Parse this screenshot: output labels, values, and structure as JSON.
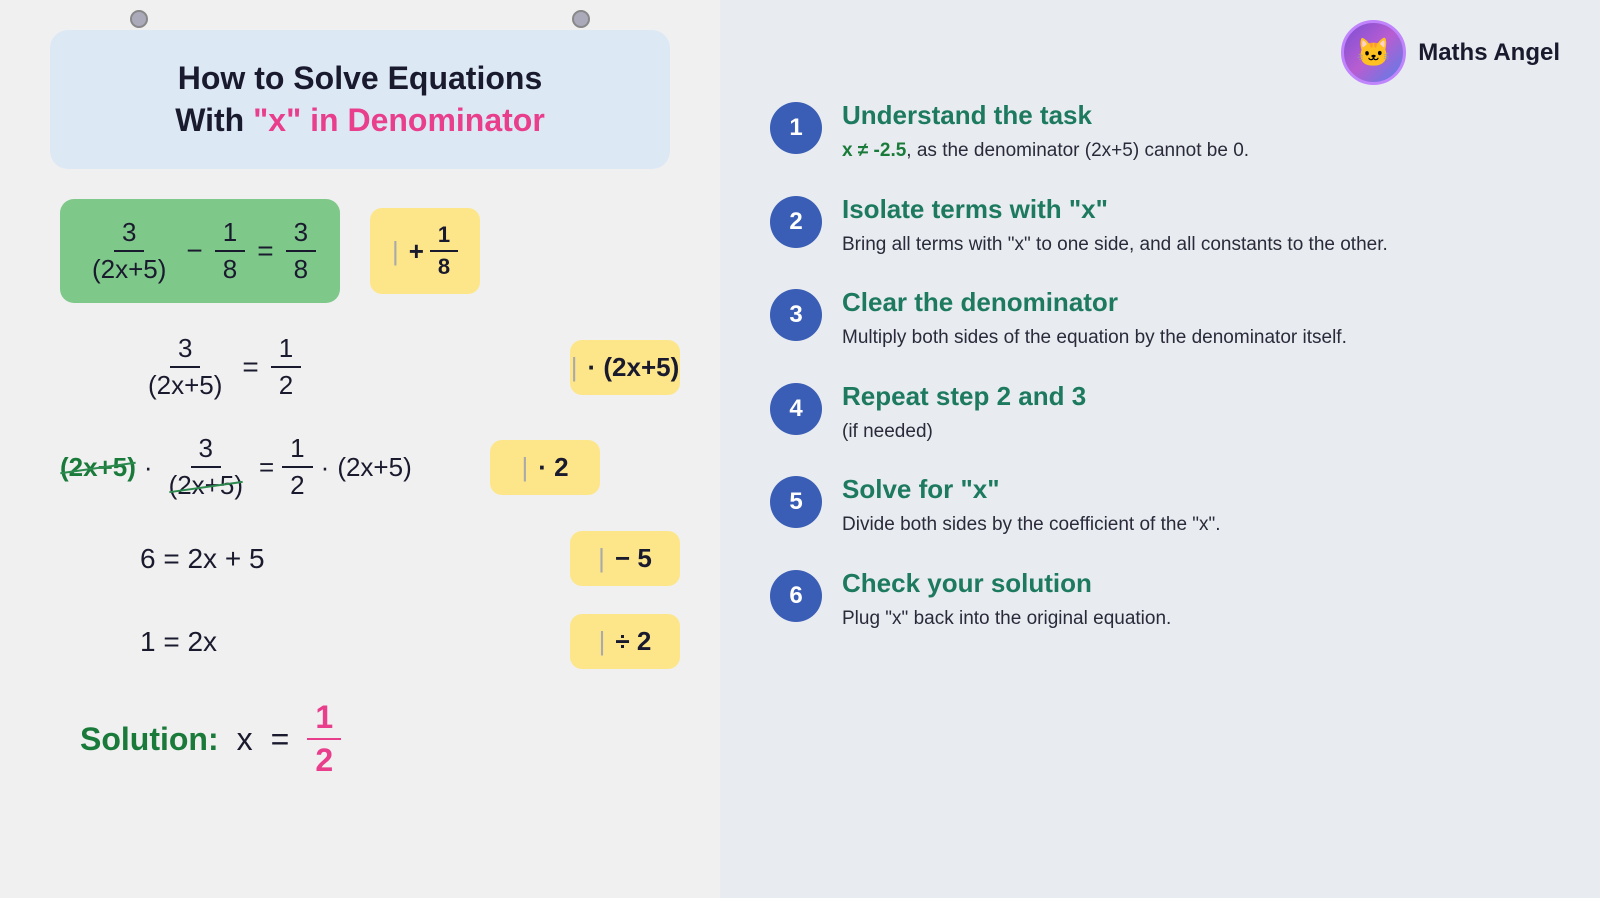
{
  "title": {
    "line1": "How to Solve Equations",
    "line2_plain": "With ",
    "line2_highlight": "\"x\"",
    "line2_end": " in Denominator"
  },
  "branding": {
    "name": "Maths Angel",
    "avatar_emoji": "🐱"
  },
  "steps": [
    {
      "number": "1",
      "title": "Understand the task",
      "desc_html": "<span class='green-inline'>x ≠ -2.5</span>, as the denominator (2x+5) cannot be 0."
    },
    {
      "number": "2",
      "title": "Isolate terms with \"x\"",
      "desc": "Bring all terms with \"x\" to one side, and all constants to the other."
    },
    {
      "number": "3",
      "title": "Clear the denominator",
      "desc": "Multiply both sides of the equation by the denominator itself."
    },
    {
      "number": "4",
      "title": "Repeat step 2 and 3",
      "desc": "(if needed)"
    },
    {
      "number": "5",
      "title": "Solve for \"x\"",
      "desc": "Divide both sides by the coefficient of the \"x\"."
    },
    {
      "number": "6",
      "title": "Check your solution",
      "desc": "Plug \"x\" back into the original equation."
    }
  ],
  "hints": {
    "h1": "+ 1/8",
    "h2": "· (2x+5)",
    "h3": "· 2",
    "h4": "- 5",
    "h5": "÷ 2"
  },
  "solution": {
    "label": "Solution:",
    "x": "x",
    "eq": "=",
    "num": "1",
    "den": "2"
  }
}
